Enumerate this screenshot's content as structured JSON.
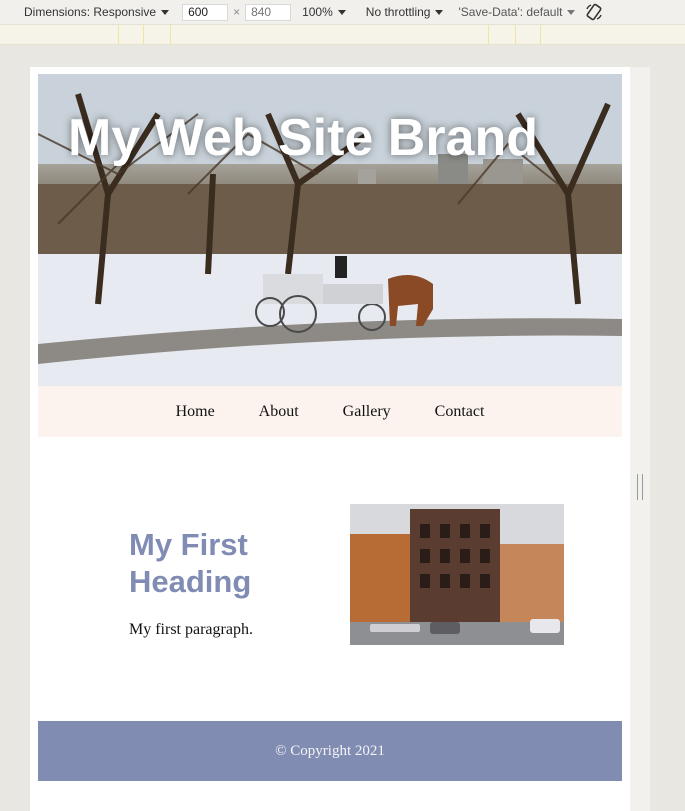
{
  "devtools": {
    "dimensions_label": "Dimensions: Responsive",
    "width_value": "600",
    "times": "×",
    "height_placeholder": "840",
    "zoom": "100%",
    "throttling": "No throttling",
    "save_data": "'Save-Data': default"
  },
  "page": {
    "brand": "My Web Site Brand",
    "nav": [
      "Home",
      "About",
      "Gallery",
      "Contact"
    ],
    "heading": "My First Heading",
    "paragraph": "My first paragraph.",
    "footer": "© Copyright 2021"
  },
  "colors": {
    "heading": "#808cb3",
    "nav_bg": "#fdf3ee",
    "footer_bg": "#808cb2"
  }
}
